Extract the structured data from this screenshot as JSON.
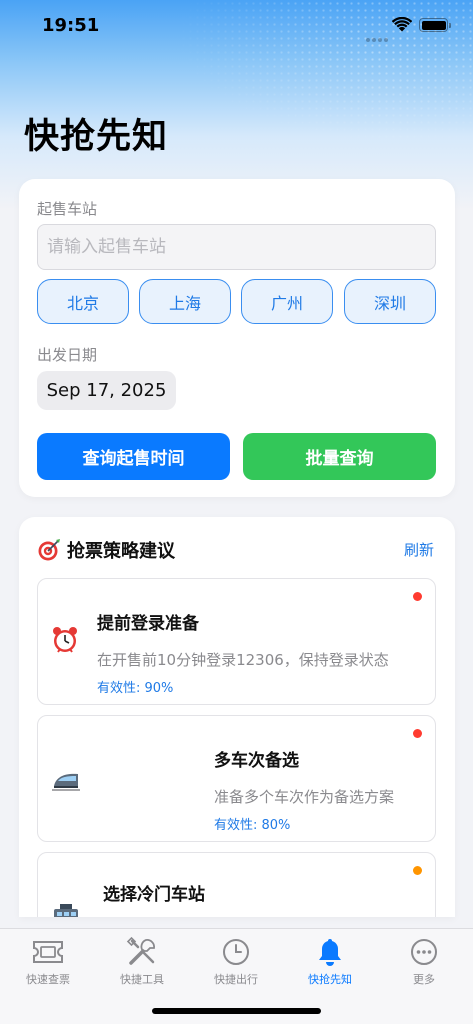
{
  "status_bar": {
    "time": "19:51"
  },
  "page_title": "快抢先知",
  "search_card": {
    "station_label": "起售车站",
    "station_placeholder": "请输入起售车站",
    "station_value": "",
    "quick_stations": [
      "北京",
      "上海",
      "广州",
      "深圳"
    ],
    "date_label": "出发日期",
    "date_value": "Sep 17, 2025",
    "query_button": "查询起售时间",
    "batch_button": "批量查询"
  },
  "strategy_card": {
    "icon": "dart-target-icon",
    "title": "抢票策略建议",
    "refresh": "刷新",
    "tips": [
      {
        "icon": "alarm-clock-icon",
        "title": "提前登录准备",
        "desc": "在开售前10分钟登录12306，保持登录状态",
        "effect": "有效性: 90%",
        "priority_color": "#ff3b30"
      },
      {
        "icon": "bullet-train-icon",
        "title": "多车次备选",
        "desc": "准备多个车次作为备选方案",
        "effect": "有效性: 80%",
        "priority_color": "#ff3b30"
      },
      {
        "icon": "station-icon",
        "title": "选择冷门车站",
        "desc": "",
        "effect": "",
        "priority_color": "#ff9500"
      }
    ]
  },
  "tabbar": {
    "items": [
      {
        "label": "快速查票",
        "icon": "ticket-icon",
        "active": false
      },
      {
        "label": "快捷工具",
        "icon": "tools-icon",
        "active": false
      },
      {
        "label": "快捷出行",
        "icon": "clock-icon",
        "active": false
      },
      {
        "label": "快抢先知",
        "icon": "bell-icon",
        "active": true
      },
      {
        "label": "更多",
        "icon": "more-icon",
        "active": false
      }
    ]
  },
  "colors": {
    "accent": "#0a7aff",
    "success": "#33c759",
    "danger": "#ff3b30",
    "warning": "#ff9500"
  }
}
